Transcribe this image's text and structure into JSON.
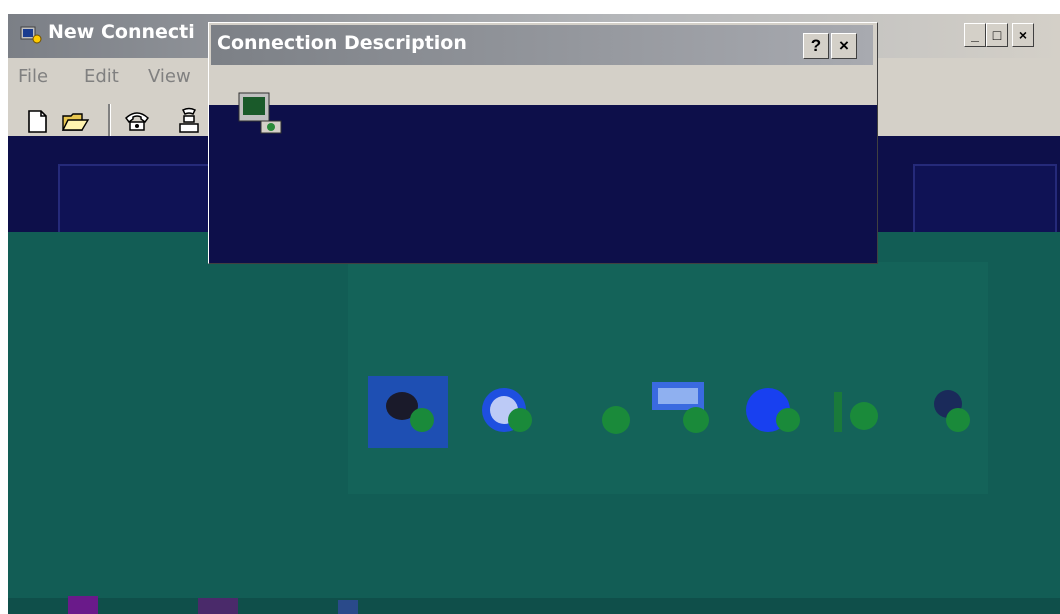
{
  "main_window": {
    "title": "New Connecti",
    "controls": {
      "minimize": "_",
      "maximize": "□",
      "close": "×"
    },
    "menu": [
      {
        "label": "File",
        "accel": "F"
      },
      {
        "label": "Edit",
        "accel": "E"
      },
      {
        "label": "View",
        "accel": "V"
      }
    ],
    "toolbar": [
      {
        "name": "new-icon"
      },
      {
        "name": "open-folder-icon"
      },
      {
        "name": "phone-icon"
      },
      {
        "name": "dial-icon"
      }
    ],
    "protocol_icons": [
      {
        "name": "phone-connection-icon"
      },
      {
        "name": "globe-connection-icon"
      },
      {
        "name": "leaf-connection-icon"
      },
      {
        "name": "card-connection-icon"
      },
      {
        "name": "blue-globe-connection-icon"
      },
      {
        "name": "plug-connection-icon"
      },
      {
        "name": "modem-connection-icon"
      }
    ]
  },
  "dialog": {
    "title": "Connection Description",
    "help_label": "?",
    "close_label": "×",
    "icon": "computer-connection-icon"
  },
  "colors": {
    "titlebar_inactive": "#7b7f86",
    "window_face": "#d4d0c8",
    "navy_area": "#0d0f4a",
    "teal_area": "#125d55"
  }
}
